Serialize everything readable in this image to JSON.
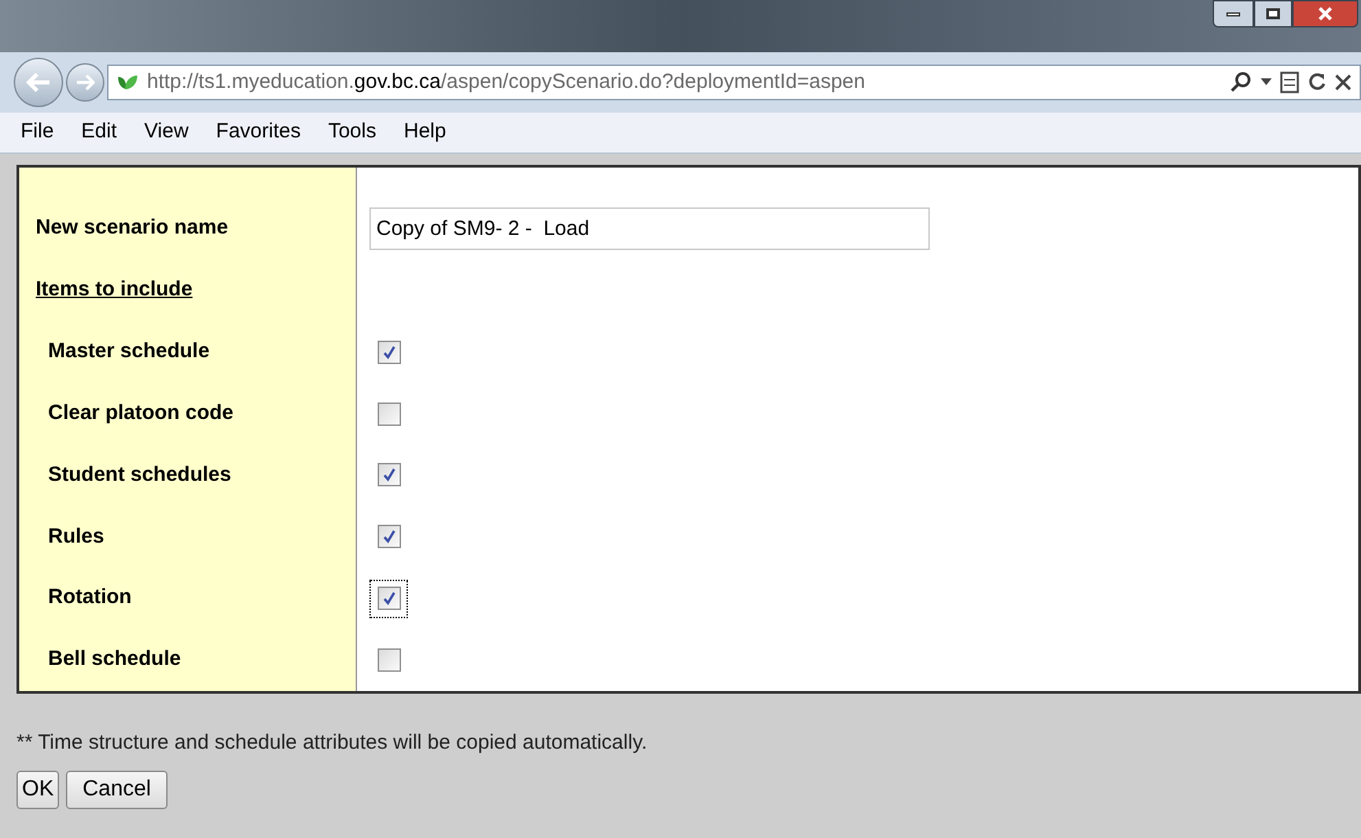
{
  "browser": {
    "url": "http://ts1.myeducation.**gov.bc.ca**/aspen/copyScenario.do?deploymentId=aspen"
  },
  "menu": [
    "File",
    "Edit",
    "View",
    "Favorites",
    "Tools",
    "Help"
  ],
  "form": {
    "name_label": "New scenario name",
    "name_value": "Copy of SM9- 2 -  Load",
    "items_heading": "Items to include",
    "items": [
      {
        "label": "Master schedule",
        "checked": true,
        "focused": false
      },
      {
        "label": "Clear platoon code",
        "checked": false,
        "focused": false
      },
      {
        "label": "Student schedules",
        "checked": true,
        "focused": false
      },
      {
        "label": "Rules",
        "checked": true,
        "focused": false
      },
      {
        "label": "Rotation",
        "checked": true,
        "focused": true
      },
      {
        "label": "Bell schedule",
        "checked": false,
        "focused": false
      }
    ]
  },
  "note": "** Time structure and schedule attributes will be copied automatically.",
  "buttons": [
    "OK",
    "Cancel"
  ]
}
